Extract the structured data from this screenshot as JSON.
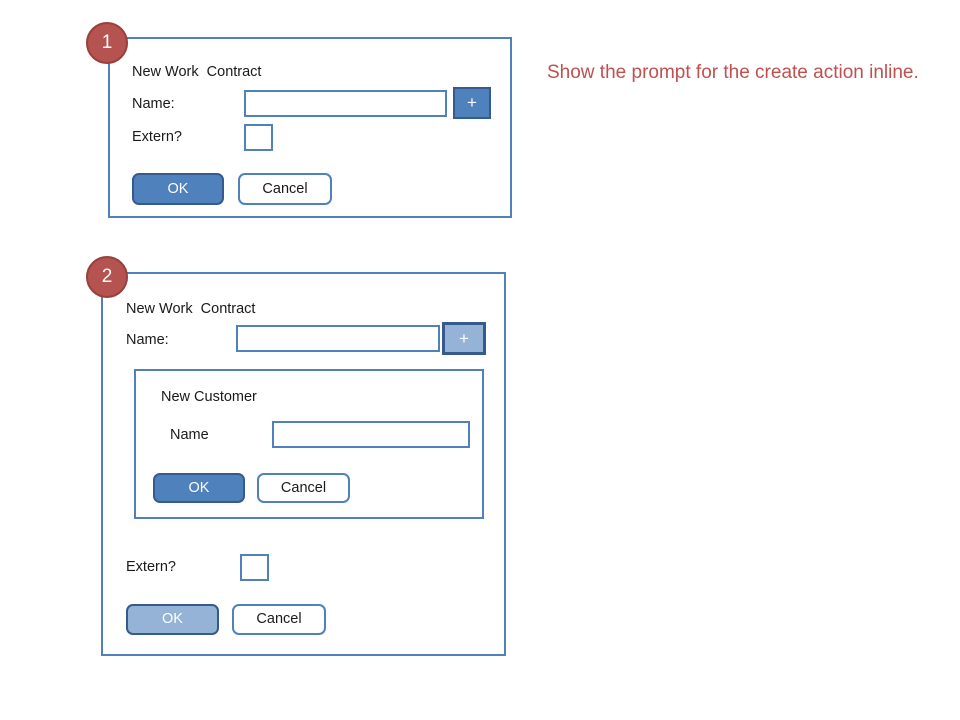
{
  "annotation": {
    "text": "Show the prompt for the create action inline."
  },
  "steps": [
    {
      "number": "1"
    },
    {
      "number": "2"
    }
  ],
  "panel_1": {
    "title": "New Work  Contract",
    "name_label": "Name:",
    "name_value": "",
    "name_placeholder": "",
    "add_button_label": "+",
    "add_button_state": "enabled",
    "extern_label": "Extern?",
    "extern_checked": false,
    "ok_label": "OK",
    "ok_state": "enabled",
    "cancel_label": "Cancel"
  },
  "panel_2": {
    "title": "New Work  Contract",
    "name_label": "Name:",
    "name_value": "",
    "name_placeholder": "",
    "add_button_label": "+",
    "add_button_state": "disabled",
    "inner_dialog": {
      "title": "New Customer",
      "name_label": "Name",
      "name_value": "",
      "name_placeholder": "",
      "ok_label": "OK",
      "ok_state": "enabled",
      "cancel_label": "Cancel"
    },
    "extern_label": "Extern?",
    "extern_checked": false,
    "ok_label": "OK",
    "ok_state": "disabled",
    "cancel_label": "Cancel"
  },
  "colors": {
    "wireframe_border": "#4f81bd",
    "button_primary": "#4f81bd",
    "button_primary_disabled": "#95b3d7",
    "button_border_dark": "#36598e",
    "badge_fill": "#b4534f",
    "badge_border": "#97403c",
    "annotation_text": "#c0504d",
    "background": "#ffffff"
  }
}
